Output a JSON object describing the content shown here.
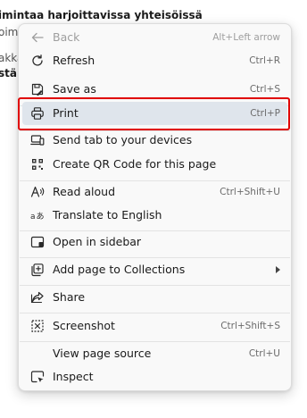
{
  "background": {
    "line1": "imintaa harjoittavissa yhteisöissä",
    "line2": "oimit",
    "line3": "akka",
    "line4": "stä l"
  },
  "menu": {
    "items": [
      {
        "label": "Back",
        "shortcut": "Alt+Left arrow",
        "icon": "back-arrow-icon",
        "disabled": true
      },
      {
        "label": "Refresh",
        "shortcut": "Ctrl+R",
        "icon": "refresh-icon"
      },
      {
        "label": "Save as",
        "shortcut": "Ctrl+S",
        "icon": "save-as-icon"
      },
      {
        "label": "Print",
        "shortcut": "Ctrl+P",
        "icon": "printer-icon",
        "highlighted": true
      },
      {
        "label": "Send tab to your devices",
        "shortcut": "",
        "icon": "send-tab-icon"
      },
      {
        "label": "Create QR Code for this page",
        "shortcut": "",
        "icon": "qr-code-icon"
      },
      {
        "label": "Read aloud",
        "shortcut": "Ctrl+Shift+U",
        "icon": "read-aloud-icon"
      },
      {
        "label": "Translate to English",
        "shortcut": "",
        "icon": "translate-icon"
      },
      {
        "label": "Open in sidebar",
        "shortcut": "",
        "icon": "sidebar-icon"
      },
      {
        "label": "Add page to Collections",
        "shortcut": "",
        "icon": "collections-icon",
        "submenu": true
      },
      {
        "label": "Share",
        "shortcut": "",
        "icon": "share-icon"
      },
      {
        "label": "Screenshot",
        "shortcut": "Ctrl+Shift+S",
        "icon": "screenshot-icon"
      },
      {
        "label": "View page source",
        "shortcut": "Ctrl+U",
        "icon": ""
      },
      {
        "label": "Inspect",
        "shortcut": "",
        "icon": "inspect-icon"
      }
    ]
  },
  "colors": {
    "highlight": "#dfe5ec",
    "focus_border": "#e00000",
    "menu_background": "#f9f9f9"
  }
}
